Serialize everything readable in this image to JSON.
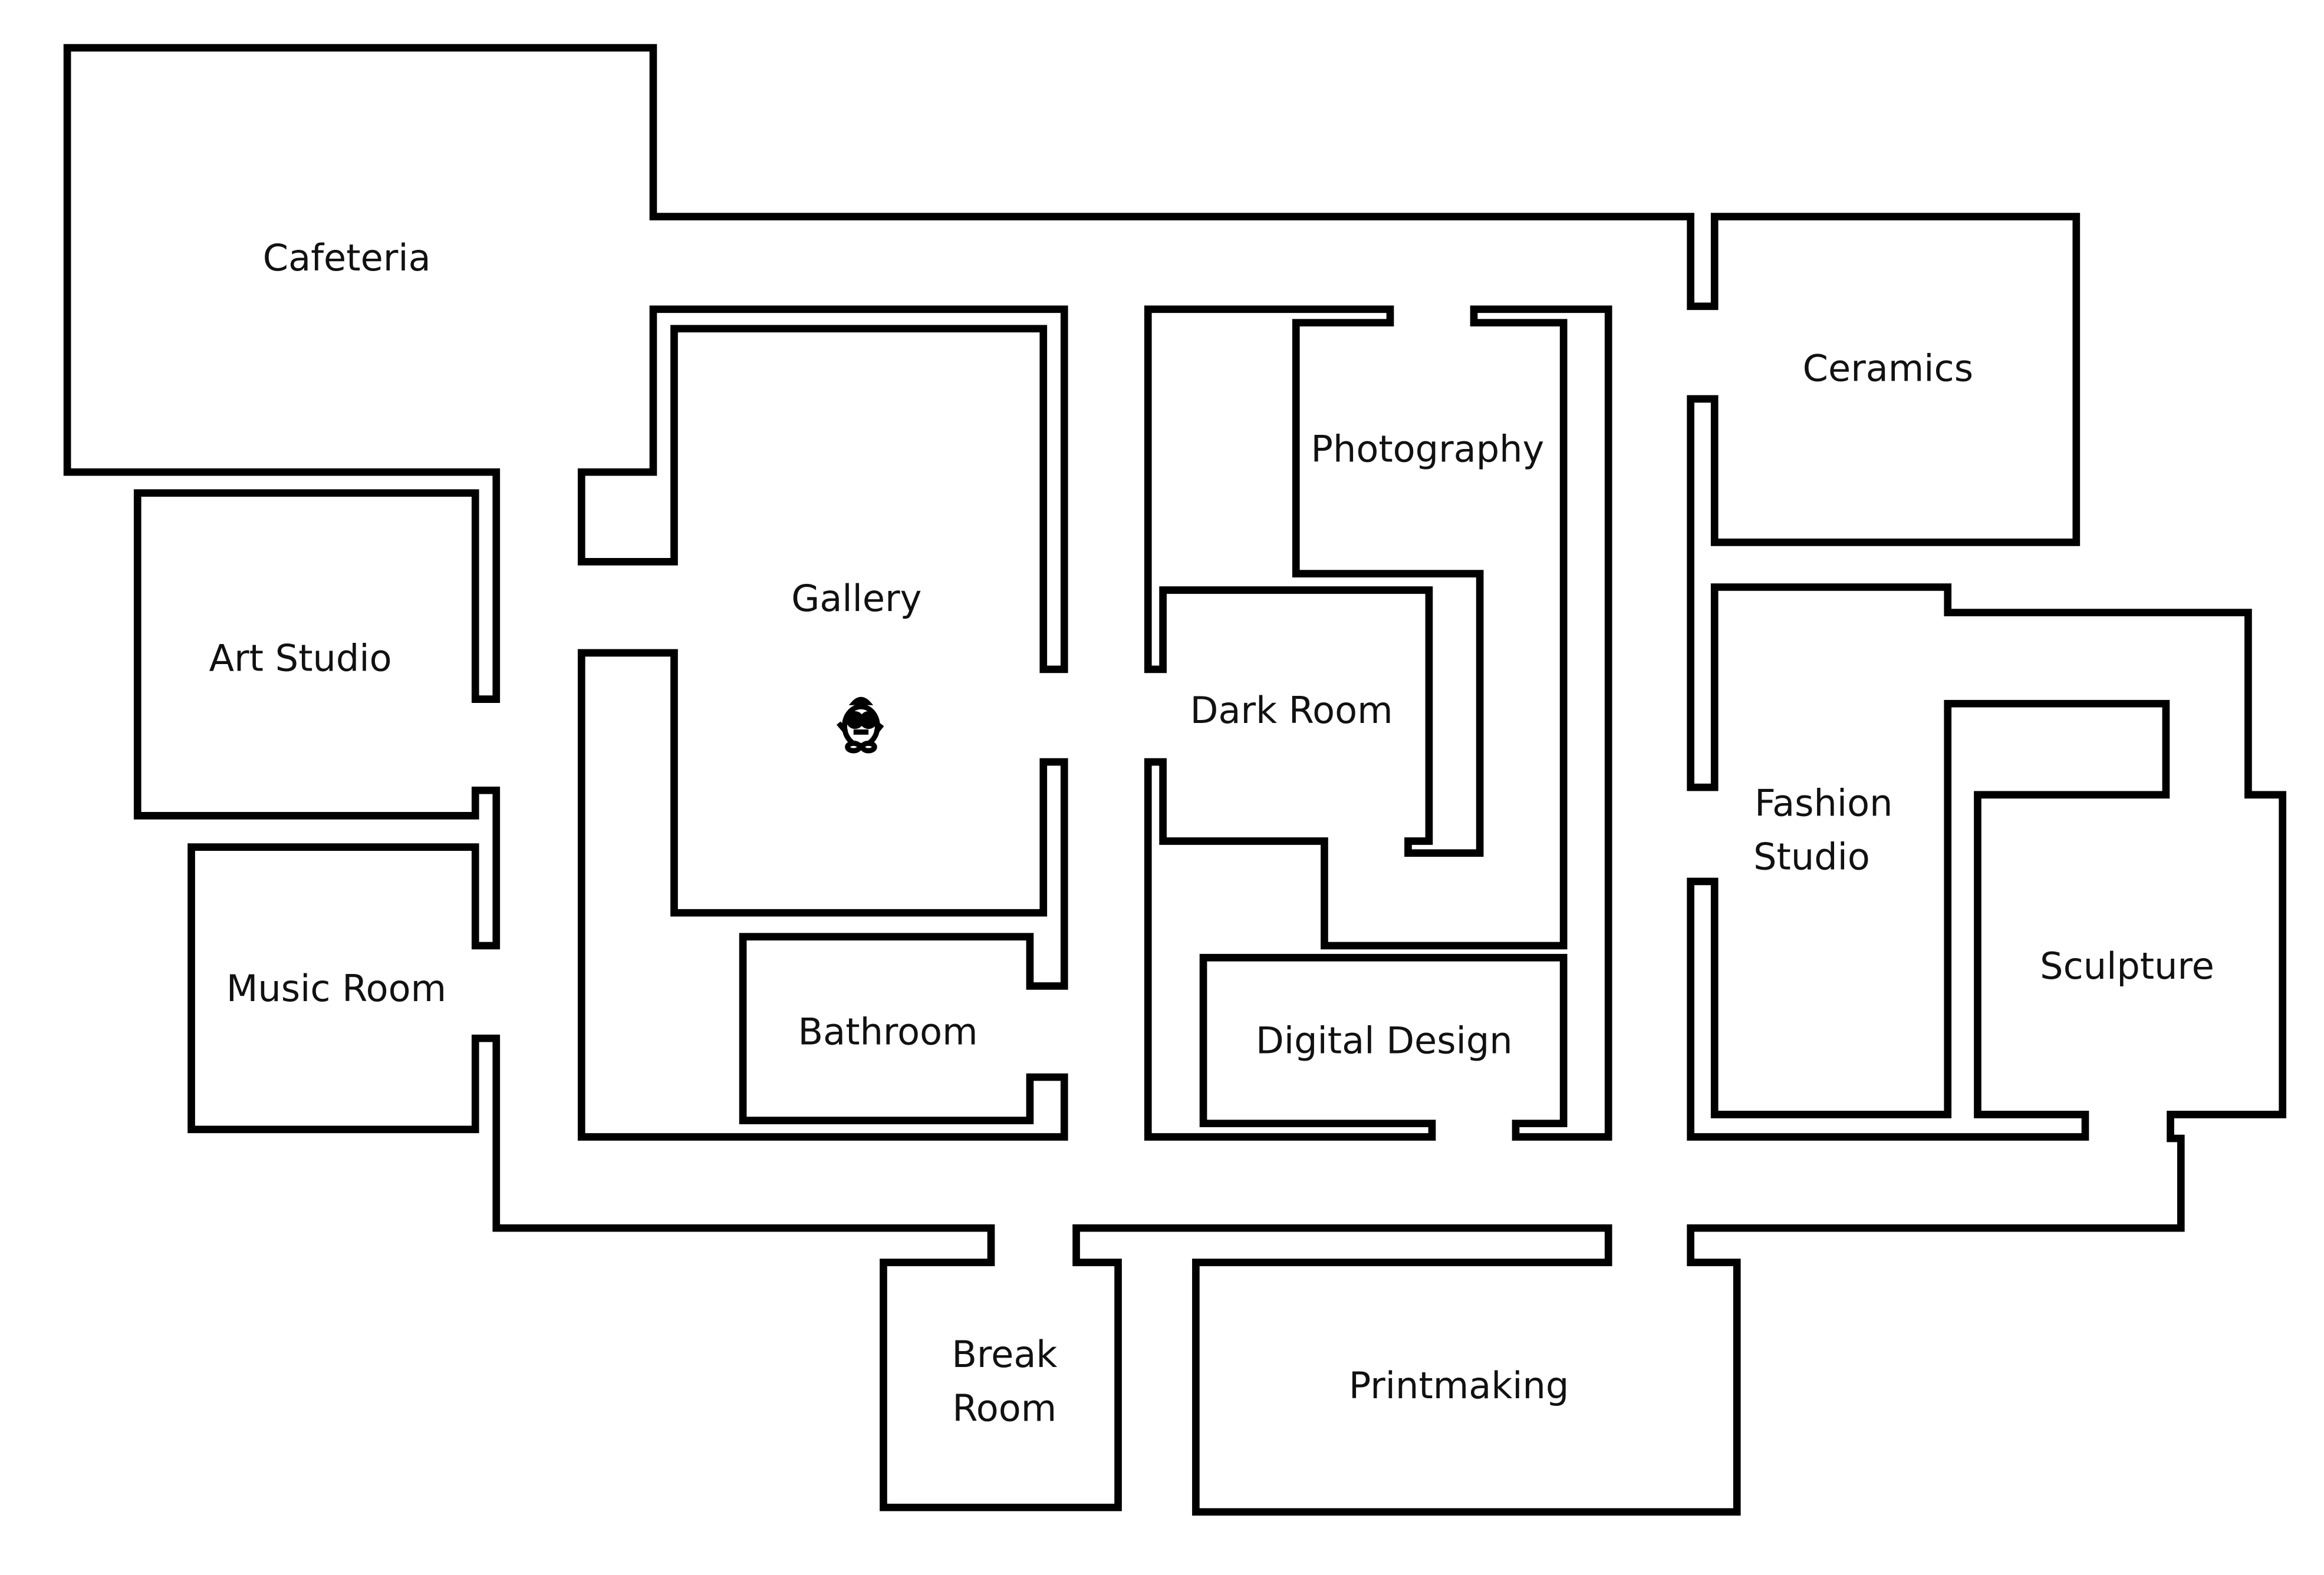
{
  "map": {
    "rooms": [
      {
        "id": "cafeteria",
        "label": "Cafeteria"
      },
      {
        "id": "art-studio",
        "label": "Art Studio"
      },
      {
        "id": "music-room",
        "label": "Music Room"
      },
      {
        "id": "gallery",
        "label": "Gallery"
      },
      {
        "id": "bathroom",
        "label": "Bathroom"
      },
      {
        "id": "photography",
        "label": "Photography"
      },
      {
        "id": "dark-room",
        "label": "Dark Room"
      },
      {
        "id": "digital-design",
        "label": "Digital Design"
      },
      {
        "id": "ceramics",
        "label": "Ceramics"
      },
      {
        "id": "fashion-studio",
        "label": "Fashion Studio",
        "lines": [
          "Fashion",
          "Studio"
        ]
      },
      {
        "id": "sculpture",
        "label": "Sculpture"
      },
      {
        "id": "break-room",
        "label": "Break Room",
        "lines": [
          "Break",
          "Room"
        ]
      },
      {
        "id": "printmaking",
        "label": "Printmaking"
      }
    ],
    "player": {
      "location": "Gallery",
      "icon": "character-icon"
    }
  }
}
